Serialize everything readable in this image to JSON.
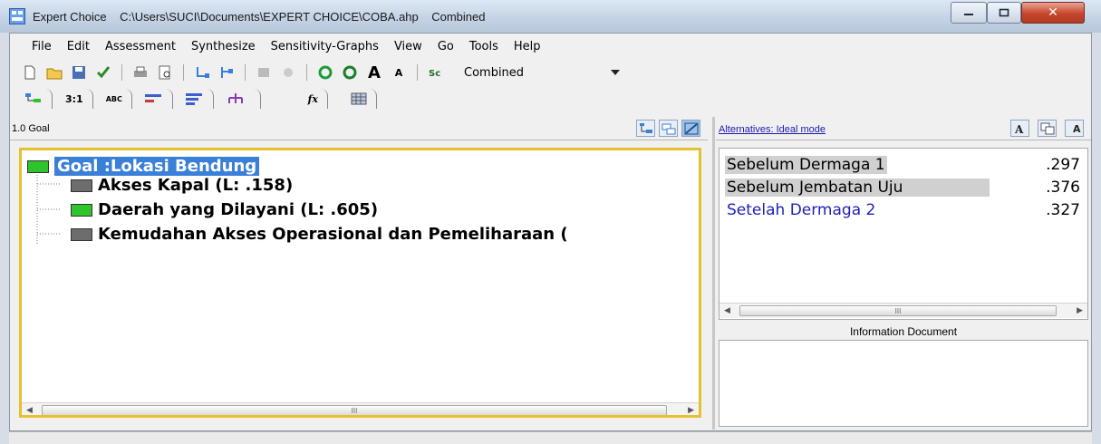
{
  "window": {
    "title": "Expert Choice    C:\\Users\\SUCI\\Documents\\EXPERT CHOICE\\COBA.ahp    Combined"
  },
  "menu": [
    "File",
    "Edit",
    "Assessment",
    "Synthesize",
    "Sensitivity-Graphs",
    "View",
    "Go",
    "Tools",
    "Help"
  ],
  "toolbar": {
    "combo_value": "Combined",
    "text_size_label": "A"
  },
  "tabs": {
    "pairwise": "3:1",
    "abc": "ABC",
    "formula": "fx"
  },
  "left_pane": {
    "path": "1.0 Goal",
    "goal": "Goal :Lokasi Bendung",
    "nodes": [
      "Akses Kapal (L: .158)",
      "Daerah yang Dilayani (L: .605)",
      "Kemudahan Akses Operasional dan Pemeliharaan ("
    ],
    "scroll_grip": "III"
  },
  "right_pane": {
    "link": "Alternatives: Ideal mode",
    "alternatives": [
      {
        "name": "Sebelum Dermaga 1",
        "value": ".297"
      },
      {
        "name": "Sebelum Jembatan Uju",
        "value": ".376"
      },
      {
        "name": "Setelah Dermaga 2",
        "value": ".327"
      }
    ],
    "scroll_grip": "III",
    "info_label": "Information Document"
  },
  "colors": {
    "selection": "#3a7fd8",
    "goal_box": "#2ec42e",
    "node_box_gray": "#6d6d6d",
    "node_box_green": "#2ec42e",
    "tree_border": "#e5c12d",
    "alt_blue": "#1f1fb5"
  }
}
